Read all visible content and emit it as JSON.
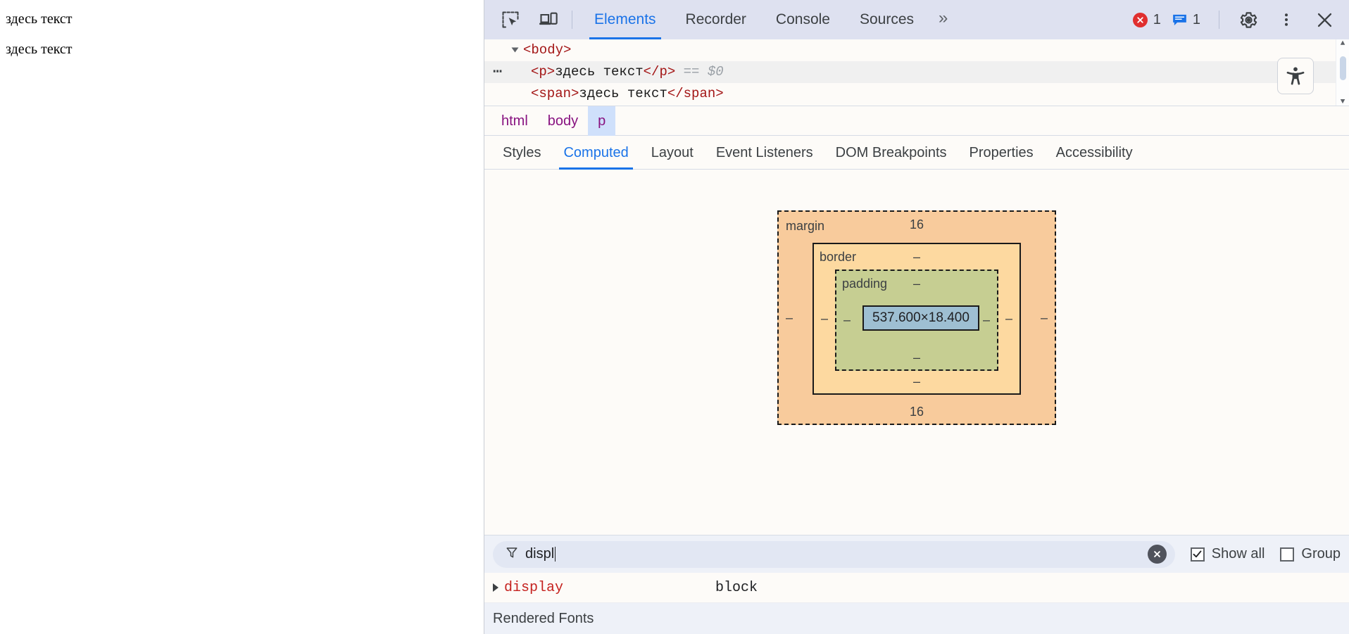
{
  "page": {
    "paragraph_text": "здесь текст",
    "span_text": "здесь текст"
  },
  "devtools": {
    "toolbar": {
      "inspect_icon": "inspect-element-icon",
      "device_icon": "device-toolbar-icon",
      "tabs": [
        {
          "label": "Elements",
          "active": true
        },
        {
          "label": "Recorder",
          "active": false
        },
        {
          "label": "Console",
          "active": false
        },
        {
          "label": "Sources",
          "active": false
        }
      ],
      "more_tabs_label": "»",
      "error_count": "1",
      "message_count": "1",
      "settings_icon": "gear-icon",
      "more_icon": "kebab-menu-icon",
      "close_icon": "close-icon"
    },
    "dom_tree": {
      "rows": [
        {
          "indent": 1,
          "has_triangle": true,
          "has_dots": false,
          "selected": false,
          "open_tag": "<body>",
          "text": "",
          "close_tag": "",
          "suffix": ""
        },
        {
          "indent": 2,
          "has_triangle": false,
          "has_dots": true,
          "selected": true,
          "open_tag": "<p>",
          "text": "здесь текст",
          "close_tag": "</p>",
          "suffix": "== $0"
        },
        {
          "indent": 2,
          "has_triangle": false,
          "has_dots": false,
          "selected": false,
          "open_tag": "<span>",
          "text": "здесь текст",
          "close_tag": "</span>",
          "suffix": ""
        }
      ],
      "a11y_button_icon": "accessibility-person-icon"
    },
    "breadcrumb": {
      "items": [
        {
          "label": "html",
          "selected": false
        },
        {
          "label": "body",
          "selected": false
        },
        {
          "label": "p",
          "selected": true
        }
      ]
    },
    "sidebar_tabs": [
      {
        "label": "Styles",
        "active": false
      },
      {
        "label": "Computed",
        "active": true
      },
      {
        "label": "Layout",
        "active": false
      },
      {
        "label": "Event Listeners",
        "active": false
      },
      {
        "label": "DOM Breakpoints",
        "active": false
      },
      {
        "label": "Properties",
        "active": false
      },
      {
        "label": "Accessibility",
        "active": false
      }
    ],
    "box_model": {
      "margin_label": "margin",
      "margin_top": "16",
      "margin_right": "–",
      "margin_bottom": "16",
      "margin_left": "–",
      "border_label": "border",
      "border_top": "–",
      "border_right": "–",
      "border_bottom": "–",
      "border_left": "–",
      "padding_label": "padding",
      "padding_top": "–",
      "padding_right": "–",
      "padding_bottom": "–",
      "padding_left": "–",
      "content_size": "537.600×18.400",
      "colors": {
        "margin": "#f8cb9c",
        "border": "#fdd9a0",
        "padding": "#c6ce92",
        "content": "#9ebfd2"
      }
    },
    "filter_bar": {
      "filter_icon": "filter-funnel-icon",
      "filter_value": "displ",
      "clear_icon": "clear-x-icon",
      "show_all_label": "Show all",
      "show_all_checked": true,
      "group_label": "Group",
      "group_checked": false
    },
    "properties": [
      {
        "name": "display",
        "value": "block"
      }
    ],
    "rendered_fonts_label": "Rendered Fonts"
  }
}
